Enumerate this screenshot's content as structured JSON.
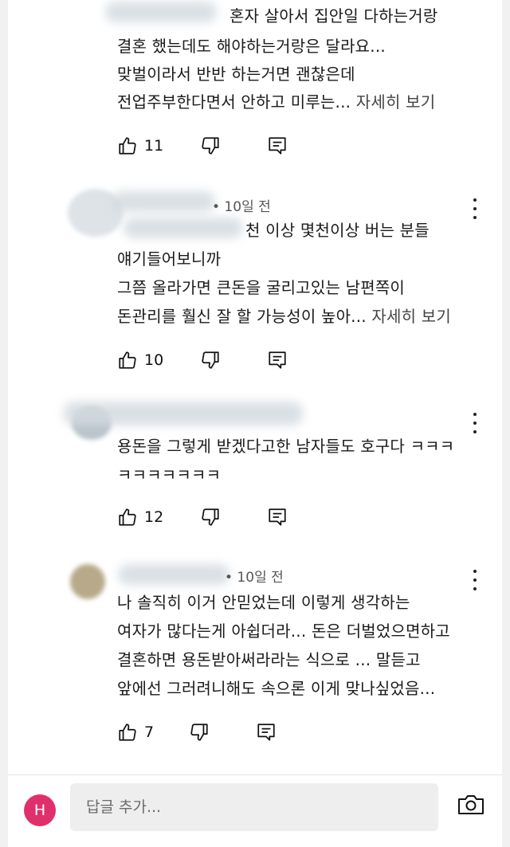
{
  "comments": [
    {
      "meta": "",
      "lines": [
        "혼자 살아서 집안일 다하는거랑",
        "결혼 했는데도 해야하는거랑은 달라요...",
        "맞벌이라서 반반 하는거면 괜찮은데",
        "전업주부한다면서 안하고 미루는..."
      ],
      "more": "자세히 보기",
      "likes": "11"
    },
    {
      "meta": "• 10일 전",
      "lines": [
        "천 이상 몇천이상 버는 분들",
        "얘기들어보니까",
        "그쯤 올라가면 큰돈을 굴리고있는 남편쪽이",
        "돈관리를 훨신 잘 할 가능성이 높아..."
      ],
      "more": "자세히 보기",
      "likes": "10"
    },
    {
      "meta": "",
      "lines": [
        "용돈을 그렇게 받겠다고한 남자들도 호구다 ㅋㅋㅋ",
        "ㅋㅋㅋㅋㅋㅋㅋ"
      ],
      "likes": "12"
    },
    {
      "meta": "• 10일 전",
      "lines": [
        "나 솔직히 이거 안믿었는데 이렇게 생각하는",
        "여자가 많다는게 아쉽더라... 돈은 더벌었으면하고",
        "결혼하면 용돈받아써라라는 식으로 ... 말듣고",
        "앞에선 그러려니해도 속으론 이게 맞나싶었음..."
      ],
      "likes": "7"
    }
  ],
  "reply_bar": {
    "avatar_letter": "H",
    "avatar_color": "#e0306b",
    "placeholder": "답글 추가..."
  },
  "icons": {
    "like": "thumbs-up-icon",
    "dislike": "thumbs-down-icon",
    "reply": "reply-comment-icon",
    "more": "more-vert-icon",
    "camera": "camera-icon"
  }
}
